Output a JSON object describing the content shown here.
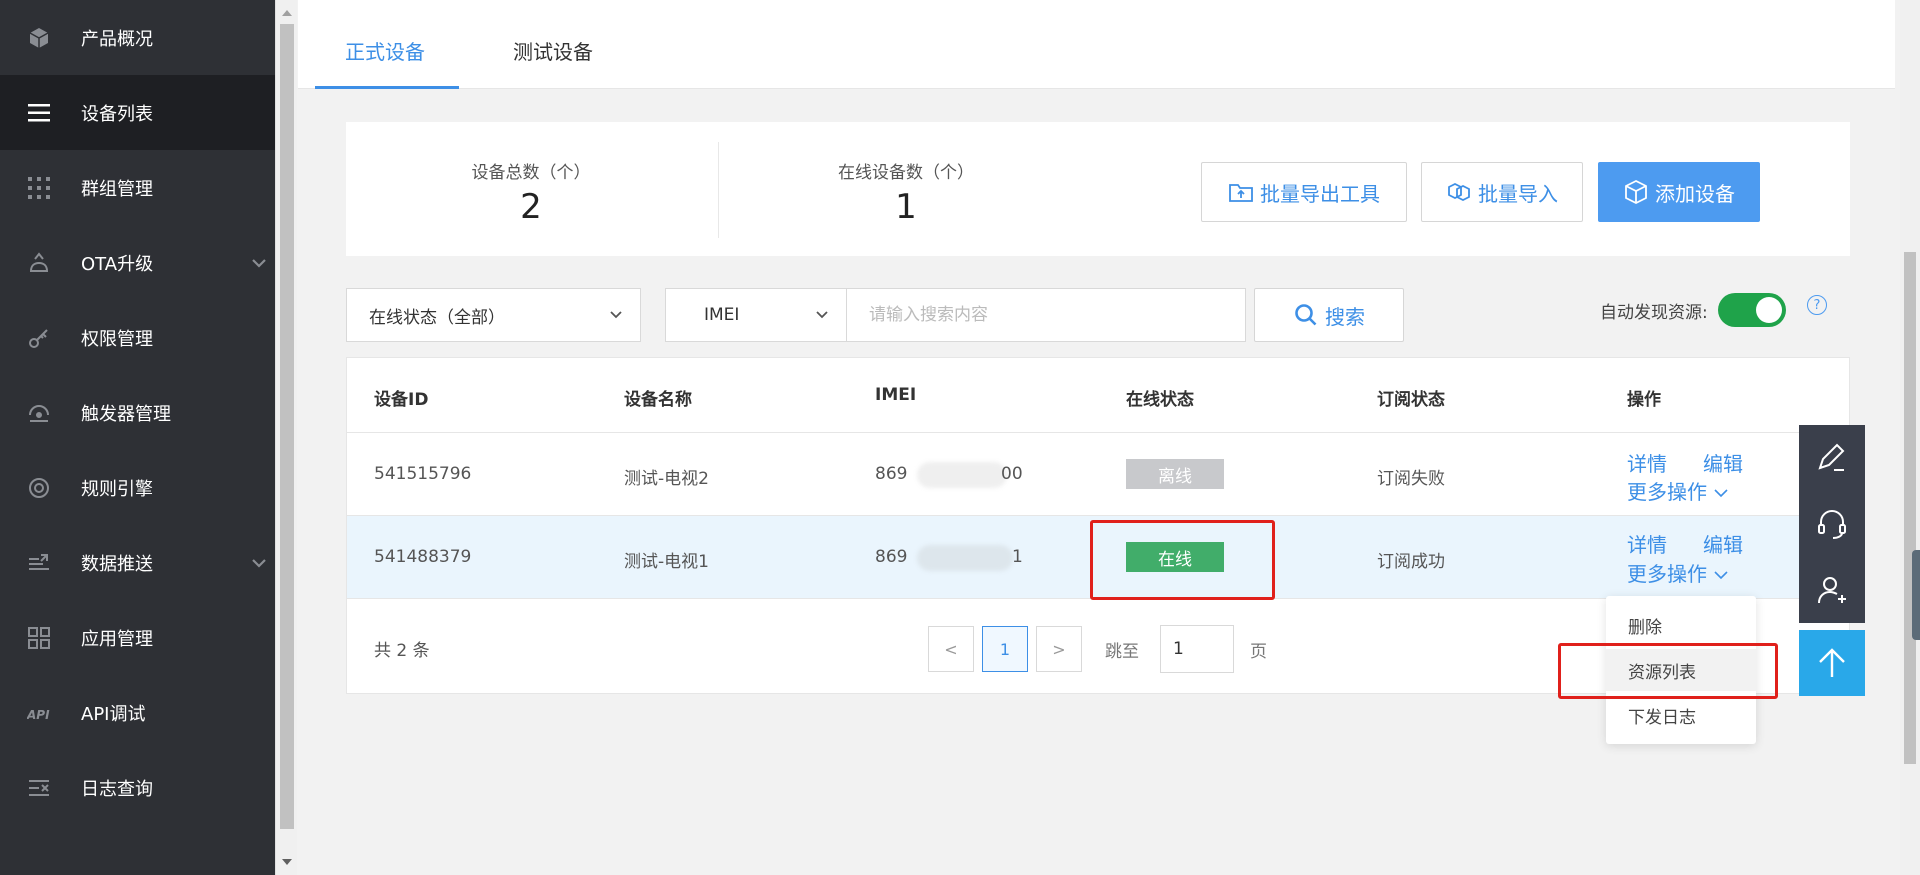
{
  "sidebar": {
    "items": [
      {
        "label": "产品概况",
        "icon": "cube-icon"
      },
      {
        "label": "设备列表",
        "icon": "list-icon"
      },
      {
        "label": "群组管理",
        "icon": "grid-dots-icon"
      },
      {
        "label": "OTA升级",
        "icon": "upgrade-icon"
      },
      {
        "label": "权限管理",
        "icon": "key-icon"
      },
      {
        "label": "触发器管理",
        "icon": "trigger-icon"
      },
      {
        "label": "规则引擎",
        "icon": "rule-icon"
      },
      {
        "label": "数据推送",
        "icon": "push-icon"
      },
      {
        "label": "应用管理",
        "icon": "apps-icon"
      },
      {
        "label": "API调试",
        "icon": "api-icon"
      },
      {
        "label": "日志查询",
        "icon": "log-icon"
      }
    ],
    "active_index": 1
  },
  "tabs": {
    "formal": "正式设备",
    "test": "测试设备"
  },
  "stats": {
    "total_label": "设备总数（个）",
    "total_value": "2",
    "online_label": "在线设备数（个）",
    "online_value": "1"
  },
  "actions": {
    "export": "批量导出工具",
    "import": "批量导入",
    "add": "添加设备"
  },
  "filters": {
    "status_select": "在线状态（全部）",
    "field_select": "IMEI",
    "search_placeholder": "请输入搜索内容",
    "search_button": "搜索",
    "auto_discover_label": "自动发现资源:",
    "auto_discover_on": true,
    "help": "?"
  },
  "table": {
    "headers": [
      "设备ID",
      "设备名称",
      "IMEI",
      "在线状态",
      "订阅状态",
      "操作"
    ],
    "rows": [
      {
        "id": "541515796",
        "name": "测试-电视2",
        "imei_prefix": "869",
        "imei_suffix": "00",
        "status": "离线",
        "subscription": "订阅失败"
      },
      {
        "id": "541488379",
        "name": "测试-电视1",
        "imei_prefix": "869",
        "imei_suffix": "1",
        "status": "在线",
        "subscription": "订阅成功"
      }
    ],
    "op_detail": "详情",
    "op_edit": "编辑",
    "op_more": "更多操作"
  },
  "pagination": {
    "total": "共 2 条",
    "prev": "<",
    "current": "1",
    "next": ">",
    "jump_label": "跳至",
    "jump_value": "1",
    "page_unit": "页"
  },
  "more_menu": {
    "items": [
      "删除",
      "资源列表",
      "下发日志"
    ]
  },
  "colors": {
    "sidebar_bg": "#2e3035",
    "accent": "#3d8fe6",
    "online": "#41ad6a",
    "offline": "#c8c9cc",
    "highlight_box": "#e0201b"
  }
}
